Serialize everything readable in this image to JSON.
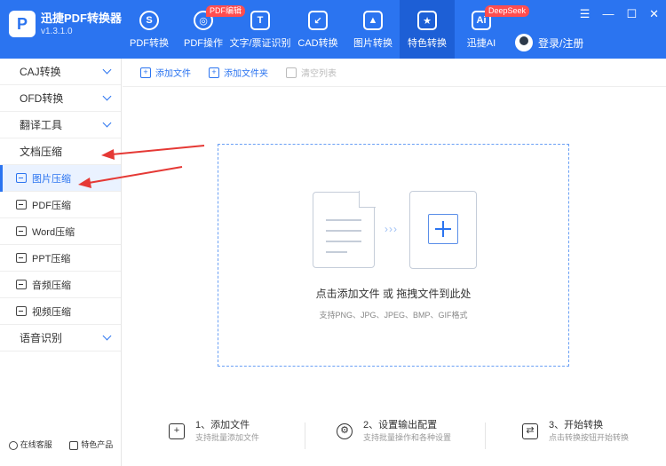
{
  "app": {
    "title": "迅捷PDF转换器",
    "version": "v1.3.1.0",
    "logo_glyph": "P"
  },
  "nav": [
    {
      "label": "PDF转换",
      "icon": "pdf-convert-icon",
      "glyph": "S",
      "badge": ""
    },
    {
      "label": "PDF操作",
      "icon": "pdf-operate-icon",
      "glyph": "◎",
      "badge": "PDF编辑"
    },
    {
      "label": "文字/票证识别",
      "icon": "ocr-icon",
      "glyph": "T",
      "badge": ""
    },
    {
      "label": "CAD转换",
      "icon": "cad-icon",
      "glyph": "↙",
      "badge": ""
    },
    {
      "label": "图片转换",
      "icon": "image-convert-icon",
      "glyph": "▲",
      "badge": ""
    },
    {
      "label": "特色转换",
      "icon": "special-convert-icon",
      "glyph": "★",
      "badge": "",
      "active": true
    },
    {
      "label": "迅捷AI",
      "icon": "ai-icon",
      "glyph": "Ai",
      "badge": "DeepSeek"
    }
  ],
  "user": {
    "login_label": "登录/注册"
  },
  "window": {
    "menu": "☰",
    "minimize": "—",
    "maximize": "☐",
    "close": "✕"
  },
  "sidebar": {
    "groups": [
      {
        "label": "CAJ转换",
        "expandable": true
      },
      {
        "label": "OFD转换",
        "expandable": true
      },
      {
        "label": "翻译工具",
        "expandable": true
      },
      {
        "label": "文档压缩",
        "expandable": false
      }
    ],
    "sub_items": [
      {
        "label": "图片压缩",
        "active": true
      },
      {
        "label": "PDF压缩",
        "active": false
      },
      {
        "label": "Word压缩",
        "active": false
      },
      {
        "label": "PPT压缩",
        "active": false
      },
      {
        "label": "音频压缩",
        "active": false
      },
      {
        "label": "视频压缩",
        "active": false
      }
    ],
    "group_after": {
      "label": "语音识别",
      "expandable": true
    },
    "bottom": {
      "service_label": "在线客服",
      "products_label": "特色产品"
    }
  },
  "toolbar": {
    "add_file": "添加文件",
    "add_folder": "添加文件夹",
    "clear_list": "清空列表"
  },
  "dropzone": {
    "main_text": "点击添加文件 或 拖拽文件到此处",
    "sub_text": "支持PNG、JPG、JPEG、BMP、GIF格式",
    "arrows": "›››"
  },
  "steps": [
    {
      "title": "1、添加文件",
      "desc": "支持批量添加文件",
      "icon": "add-file-icon",
      "glyph": "+"
    },
    {
      "title": "2、设置输出配置",
      "desc": "支持批量操作和各种设置",
      "icon": "settings-gear-icon",
      "glyph": "⚙"
    },
    {
      "title": "3、开始转换",
      "desc": "点击转换按钮开始转换",
      "icon": "start-convert-icon",
      "glyph": "⇄"
    }
  ],
  "colors": {
    "accent": "#2b74f0",
    "annotation": "#e53935"
  }
}
